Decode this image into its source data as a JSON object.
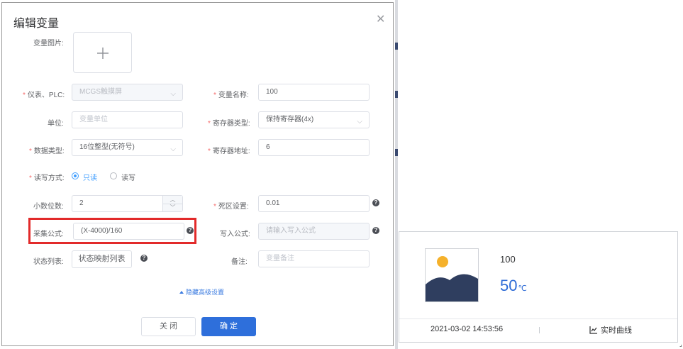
{
  "dialog": {
    "title": "编辑变量",
    "close_icon": "close-icon",
    "image_label": "变量图片:",
    "plc_label": "仪表、PLC:",
    "plc_value": "MCGS触摸屏",
    "name_label": "变量名称:",
    "name_value": "100",
    "unit_label": "单位:",
    "unit_placeholder": "变量单位",
    "register_type_label": "寄存器类型:",
    "register_type_value": "保持寄存器(4x)",
    "data_type_label": "数据类型:",
    "data_type_value": "16位整型(无符号)",
    "register_addr_label": "寄存器地址:",
    "register_addr_value": "6",
    "rw_label": "读写方式:",
    "rw_options": [
      "只读",
      "读写"
    ],
    "rw_selected": "只读",
    "decimal_label": "小数位数:",
    "decimal_value": "2",
    "deadband_label": "死区设置:",
    "deadband_value": "0.01",
    "collect_formula_label": "采集公式:",
    "collect_formula_value": "(X-4000)/160",
    "write_formula_label": "写入公式:",
    "write_formula_placeholder": "请输入写入公式",
    "status_list_label": "状态列表:",
    "status_map_button": "状态映射列表",
    "remark_label": "备注:",
    "remark_placeholder": "变量备注",
    "toggle_advanced": "隐藏高级设置",
    "cancel_button": "关 闭",
    "confirm_button": "确 定"
  },
  "card": {
    "variable_name": "100",
    "value": "50",
    "unit": "℃",
    "timestamp": "2021-03-02 14:53:56",
    "separator": "|",
    "curve_button": "实时曲线",
    "curve_icon": "line-chart-icon",
    "image_icon": "image-placeholder-icon"
  },
  "colors": {
    "primary": "#2e6fdb",
    "required": "#f56c6c",
    "highlight": "#e22a2a",
    "value_blue": "#2d6bd6",
    "sun": "#f5b12b",
    "mountain": "#2f3e5f"
  }
}
